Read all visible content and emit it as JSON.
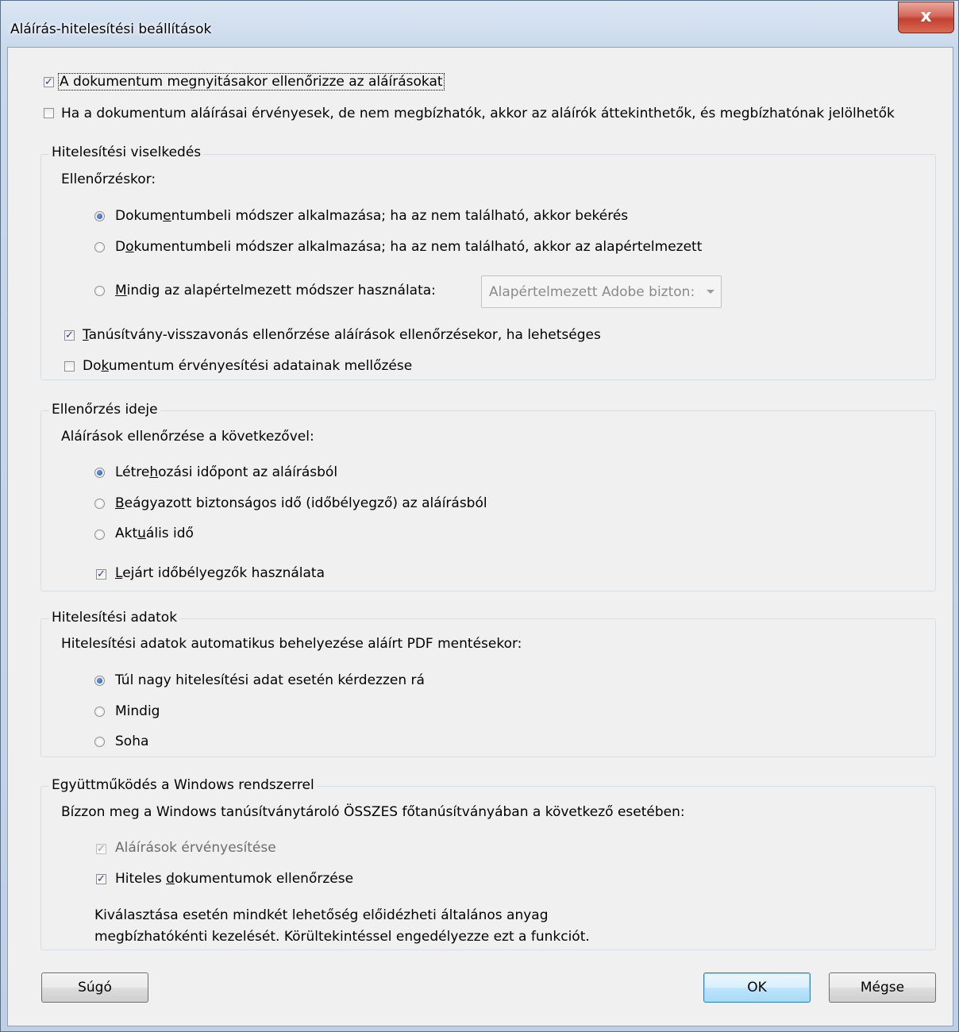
{
  "window": {
    "title": "Aláírás-hitelesítési beállítások",
    "close_glyph": "x"
  },
  "top_options": [
    {
      "label": "A dokumentum megnyitásakor ellenőrizze az aláírásokat",
      "checked": true
    },
    {
      "label": "Ha a dokumentum aláírásai érvényesek, de nem megbízhatók, akkor az aláírók áttekinthetők, és megbízhatónak jelölhetők",
      "checked": false
    }
  ],
  "verification_behavior": {
    "group_title": "Hitelesítési viselkedés",
    "prompt": "Ellenőrzéskor:",
    "radios": [
      {
        "label": "Dokumentumbeli módszer alkalmazása; ha az nem található, akkor bekérés",
        "selected": true
      },
      {
        "label": "Dokumentumbeli módszer alkalmazása; ha az nem található, akkor az alapértelmezett",
        "selected": false
      },
      {
        "label": "Mindig az alapértelmezett módszer használata:",
        "selected": false
      }
    ],
    "method_dropdown_value": "Alapértelmezett Adobe bizton:",
    "checkboxes": [
      {
        "label": "Tanúsítvány-visszavonás ellenőrzése aláírások ellenőrzésekor, ha lehetséges",
        "checked": true
      },
      {
        "label": "Dokumentum érvényesítési adatainak mellőzése",
        "checked": false
      }
    ]
  },
  "verification_time": {
    "group_title": "Ellenőrzés ideje",
    "prompt": "Aláírások ellenőrzése a következővel:",
    "radios": [
      {
        "label": "Létrehozási időpont az aláírásból",
        "selected": true
      },
      {
        "label": "Beágyazott biztonságos idő (időbélyegző) az aláírásból",
        "selected": false
      },
      {
        "label": "Aktuális idő",
        "selected": false
      }
    ],
    "checkbox": {
      "label": "Lejárt időbélyegzők használata",
      "checked": true
    }
  },
  "verification_info": {
    "group_title": "Hitelesítési adatok",
    "prompt": "Hitelesítési adatok automatikus behelyezése aláírt PDF mentésekor:",
    "radios": [
      {
        "label": "Túl nagy hitelesítési adat esetén kérdezzen rá",
        "selected": true
      },
      {
        "label": "Mindig",
        "selected": false
      },
      {
        "label": "Soha",
        "selected": false
      }
    ]
  },
  "windows_integration": {
    "group_title": "Együttműködés a Windows rendszerrel",
    "prompt": "Bízzon meg a Windows tanúsítványtároló ÖSSZES főtanúsítványában a következő esetében:",
    "checkboxes": [
      {
        "label": "Aláírások érvényesítése",
        "checked": true,
        "disabled": true
      },
      {
        "label": "Hiteles dokumentumok ellenőrzése",
        "checked": true,
        "disabled": false
      }
    ],
    "note_line1": "Kiválasztása esetén mindkét lehetőség előidézheti általános anyag",
    "note_line2": "megbízhatókénti kezelését. Körültekintéssel engedélyezze ezt a funkciót."
  },
  "buttons": {
    "help": "Súgó",
    "ok": "OK",
    "cancel": "Mégse"
  },
  "check_glyph": "✓"
}
